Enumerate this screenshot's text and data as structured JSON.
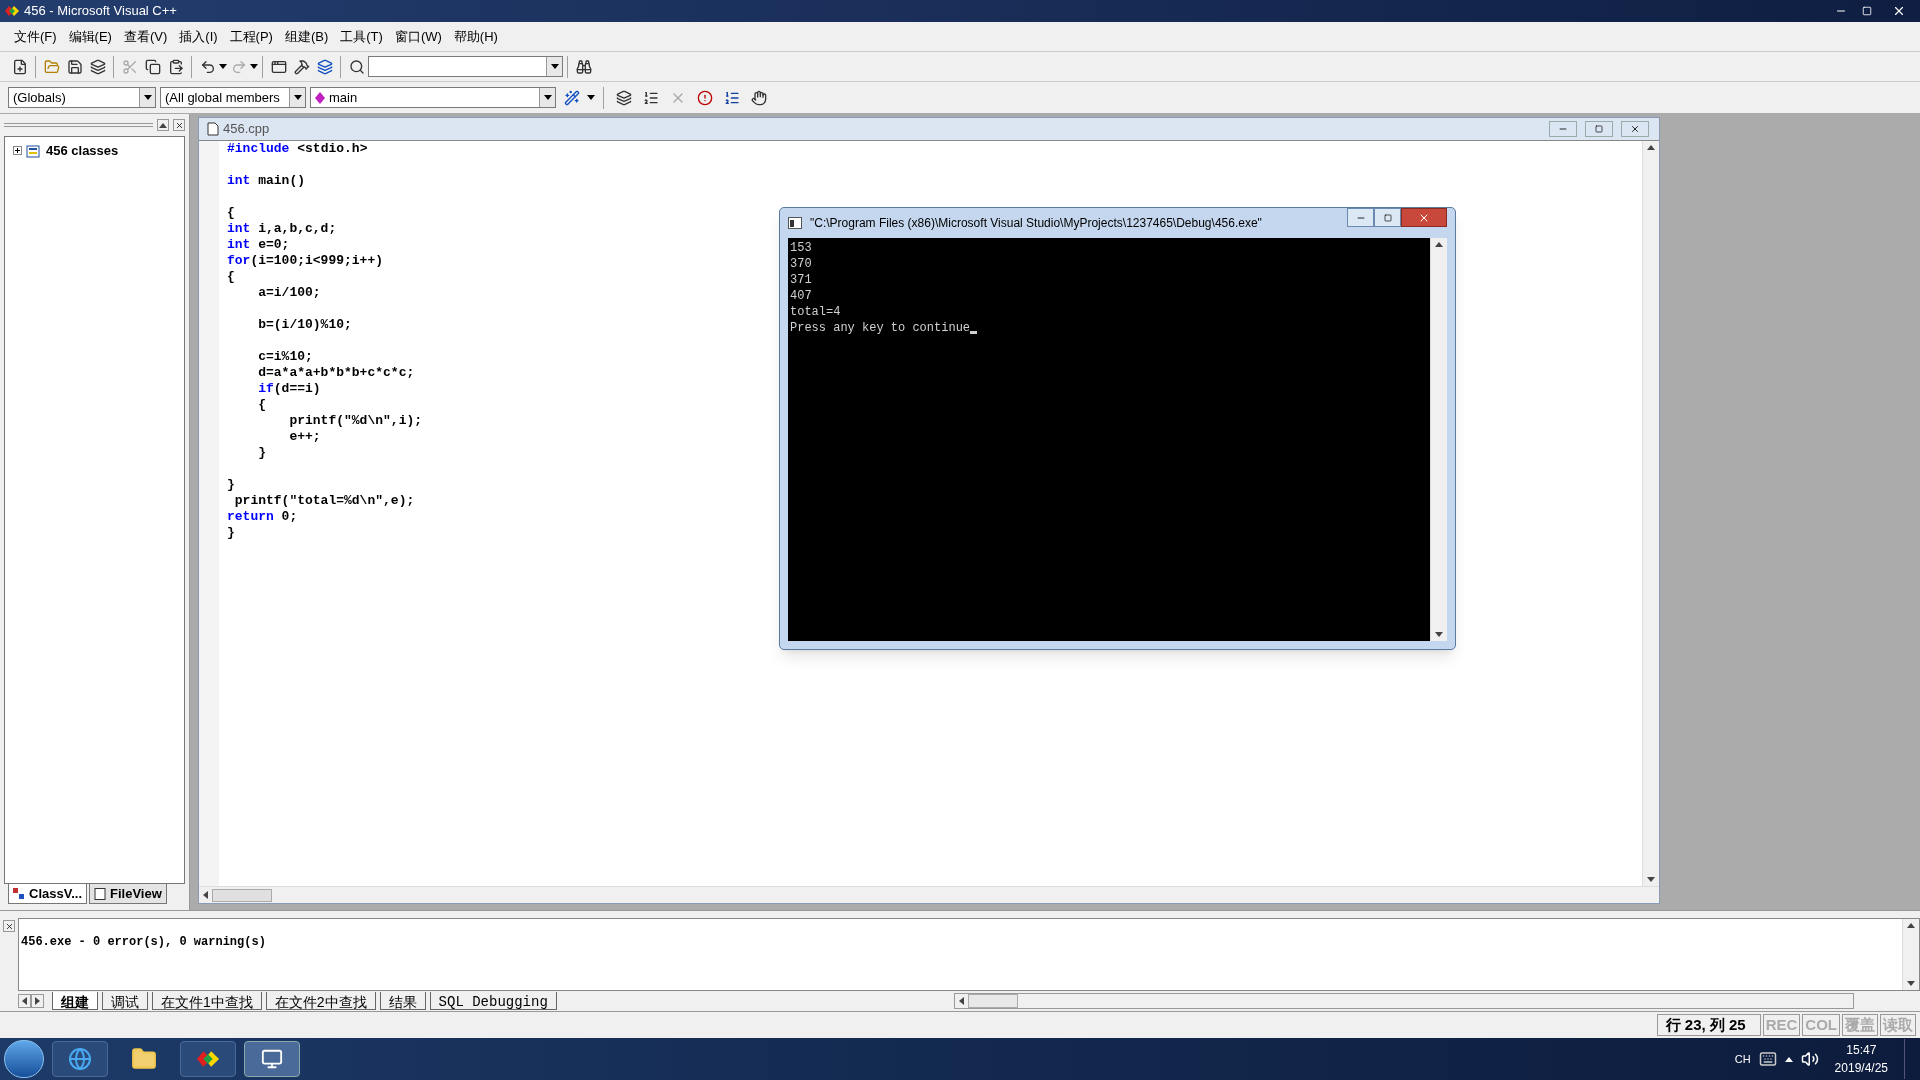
{
  "window": {
    "title": "456 - Microsoft Visual C++"
  },
  "menu": [
    "文件(F)",
    "编辑(E)",
    "查看(V)",
    "插入(I)",
    "工程(P)",
    "组建(B)",
    "工具(T)",
    "窗口(W)",
    "帮助(H)"
  ],
  "wizard_bar": {
    "scope": "(Globals)",
    "members": "(All global members",
    "function": "main"
  },
  "workspace": {
    "tree": [
      {
        "label": "456 classes",
        "expanded": false
      }
    ],
    "tabs": [
      {
        "label": "ClassV...",
        "selected": true
      },
      {
        "label": "FileView",
        "selected": false
      }
    ]
  },
  "editor": {
    "title": "456.cpp",
    "blocks": [
      [
        [
          {
            "kind": "keyword",
            "text": "#include"
          },
          {
            "kind": "text",
            "text": " <stdio.h>"
          }
        ]
      ],
      [
        [
          {
            "kind": "keyword",
            "text": "int"
          },
          {
            "kind": "text",
            "text": " main()"
          }
        ]
      ],
      [
        [
          {
            "kind": "text",
            "text": "{"
          }
        ],
        [
          {
            "kind": "keyword",
            "text": "int"
          },
          {
            "kind": "text",
            "text": " i,a,b,c,d;"
          }
        ],
        [
          {
            "kind": "keyword",
            "text": "int"
          },
          {
            "kind": "text",
            "text": " e=0;"
          }
        ],
        [
          {
            "kind": "keyword",
            "text": "for"
          },
          {
            "kind": "text",
            "text": "(i=100;i<999;i++)"
          }
        ],
        [
          {
            "kind": "text",
            "text": "{"
          }
        ],
        [
          {
            "kind": "text",
            "text": "    a=i/100;"
          }
        ]
      ],
      [
        [
          {
            "kind": "text",
            "text": "    b=(i/10)%10;"
          }
        ]
      ],
      [
        [
          {
            "kind": "text",
            "text": "    c=i%10;"
          }
        ],
        [
          {
            "kind": "text",
            "text": "    d=a*a*a+b*b*b+c*c*c;"
          }
        ],
        [
          {
            "kind": "keyword",
            "text": "    if"
          },
          {
            "kind": "text",
            "text": "(d==i)"
          }
        ],
        [
          {
            "kind": "text",
            "text": "    {"
          }
        ],
        [
          {
            "kind": "text",
            "text": "        printf(\"%d\\n\",i);"
          }
        ],
        [
          {
            "kind": "text",
            "text": "        e++;"
          }
        ],
        [
          {
            "kind": "text",
            "text": "    }"
          }
        ]
      ],
      [
        [
          {
            "kind": "text",
            "text": "}"
          }
        ],
        [
          {
            "kind": "text",
            "text": " printf(\"total=%d\\n\",e);"
          }
        ],
        [
          {
            "kind": "keyword",
            "text": "return"
          },
          {
            "kind": "text",
            "text": " 0;"
          }
        ],
        [
          {
            "kind": "text",
            "text": "}"
          }
        ]
      ]
    ]
  },
  "console": {
    "title": "\"C:\\Program Files (x86)\\Microsoft Visual Studio\\MyProjects\\1237465\\Debug\\456.exe\"",
    "lines": [
      "153",
      "370",
      "371",
      "407",
      "total=4",
      "Press any key to continue"
    ],
    "cursor": true
  },
  "output": {
    "lines": [
      "456.exe - 0 error(s), 0 warning(s)"
    ],
    "tabs": [
      {
        "label": "组建",
        "selected": true
      },
      {
        "label": "调试",
        "selected": false
      },
      {
        "label": "在文件1中查找",
        "selected": false
      },
      {
        "label": "在文件2中查找",
        "selected": false
      },
      {
        "label": "结果",
        "selected": false
      },
      {
        "label": "SQL Debugging",
        "selected": false
      }
    ]
  },
  "status_bar": {
    "position": "行 23, 列 25",
    "indicators": [
      {
        "label": "REC",
        "on": false
      },
      {
        "label": "COL",
        "on": false
      },
      {
        "label": "覆盖",
        "on": false
      },
      {
        "label": "读取",
        "on": false
      }
    ]
  },
  "taskbar": {
    "language": "CH",
    "time": "15:47",
    "date": "2019/4/25"
  }
}
